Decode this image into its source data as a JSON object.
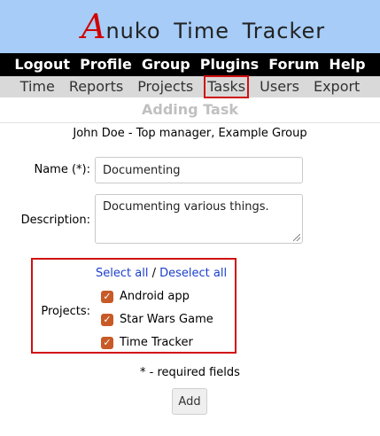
{
  "app": {
    "logo_a": "A",
    "logo_rest": "nuko Time Tracker"
  },
  "top_menu": [
    "Logout",
    "Profile",
    "Group",
    "Plugins",
    "Forum",
    "Help"
  ],
  "sub_menu": [
    "Time",
    "Reports",
    "Projects",
    "Tasks",
    "Users",
    "Export"
  ],
  "active_tab": "Tasks",
  "page_title": "Adding Task",
  "user_line": "John Doe - Top manager, Example Group",
  "form": {
    "name_label": "Name (*):",
    "name_value": "Documenting",
    "description_label": "Description:",
    "description_value": "Documenting various things.",
    "projects_label": "Projects:",
    "select_all": "Select all",
    "separator": "/",
    "deselect_all": "Deselect all",
    "projects": [
      {
        "name": "Android app",
        "checked": true
      },
      {
        "name": "Star Wars Game",
        "checked": true
      },
      {
        "name": "Time Tracker",
        "checked": true
      }
    ],
    "checkmark": "✓",
    "required_note": "* - required fields",
    "add_button": "Add"
  },
  "colors": {
    "header_bg": "#a6ccf7",
    "logo_accent": "#d20000",
    "highlight_border": "#d01010",
    "checkbox_fill": "#c85a28",
    "link": "#1a3fcc"
  }
}
